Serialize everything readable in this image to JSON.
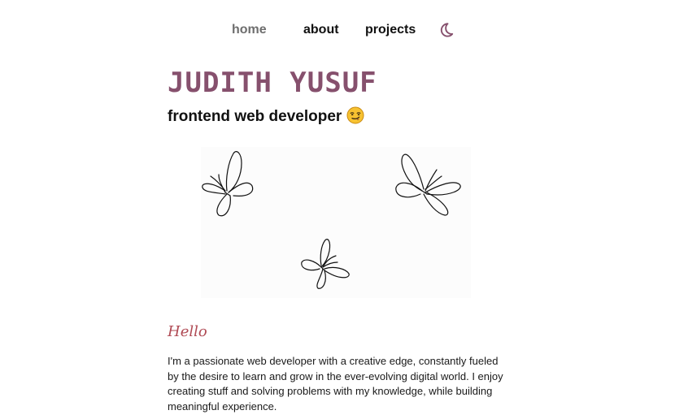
{
  "nav": {
    "items": [
      {
        "label": "home",
        "active": true
      },
      {
        "label": "about",
        "active": false
      },
      {
        "label": "projects",
        "active": false
      }
    ],
    "theme_toggle_icon": "moon-icon"
  },
  "hero": {
    "name": "JUDITH YUSUF",
    "role": "frontend web developer",
    "role_emoji_icon": "smirk-face-emoji-icon",
    "illustration_icon": "butterflies-line-art"
  },
  "intro": {
    "greeting": "Hello",
    "bio": "I'm a passionate web developer with a creative edge, constantly fueled by the desire to learn and grow in the ever-evolving digital world. I enjoy creating stuff and solving problems with my knowledge, while building meaningful experience."
  },
  "colors": {
    "accent": "#86506d",
    "greeting": "#b04b55",
    "nav_active": "#6e6e6e",
    "text": "#111111",
    "background": "#ffffff"
  }
}
